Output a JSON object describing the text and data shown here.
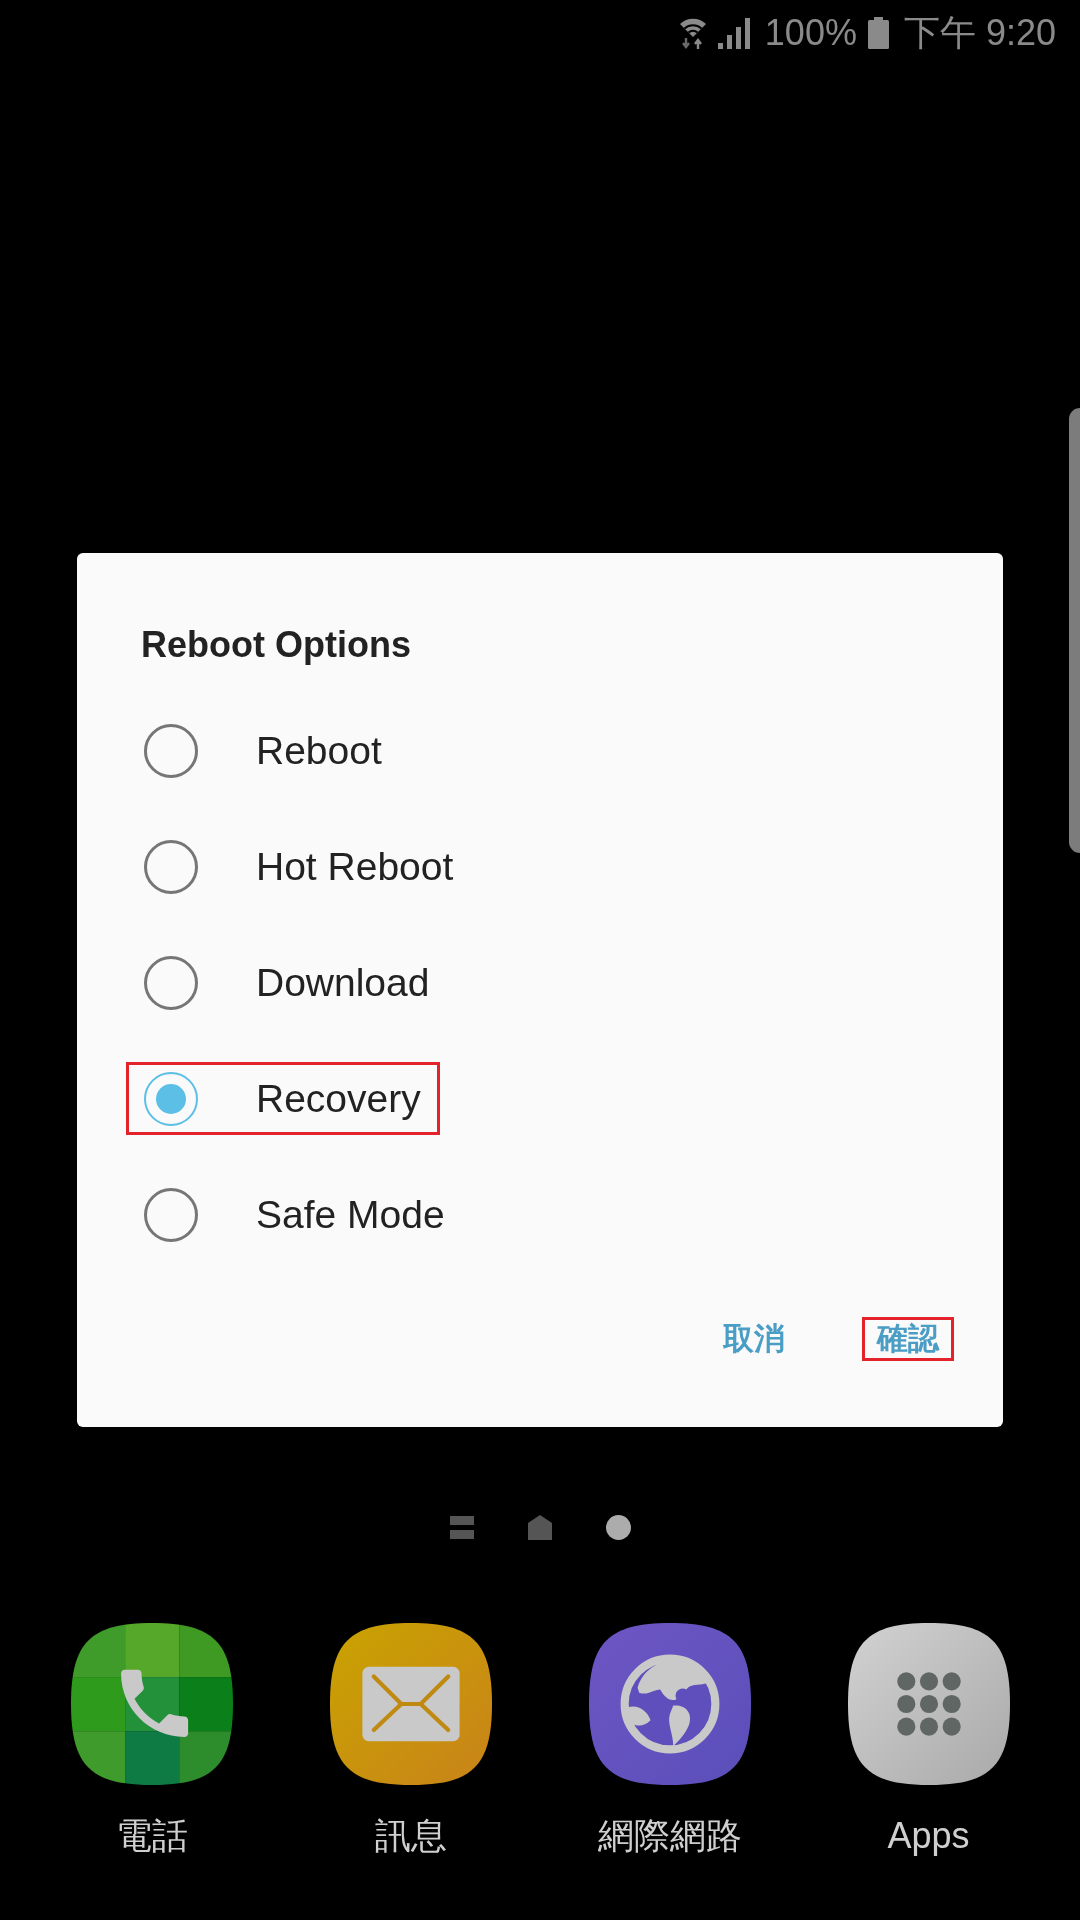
{
  "status_bar": {
    "battery_percent": "100%",
    "time": "下午 9:20"
  },
  "dialog": {
    "title": "Reboot Options",
    "options": [
      {
        "label": "Reboot",
        "selected": false,
        "highlighted": false
      },
      {
        "label": "Hot Reboot",
        "selected": false,
        "highlighted": false
      },
      {
        "label": "Download",
        "selected": false,
        "highlighted": false
      },
      {
        "label": "Recovery",
        "selected": true,
        "highlighted": true
      },
      {
        "label": "Safe Mode",
        "selected": false,
        "highlighted": false
      }
    ],
    "buttons": [
      {
        "label": "取消",
        "highlighted": false
      },
      {
        "label": "確認",
        "highlighted": true
      }
    ]
  },
  "page_indicators": [
    {
      "kind": "list",
      "selected": false
    },
    {
      "kind": "home",
      "selected": false
    },
    {
      "kind": "dot",
      "selected": true
    }
  ],
  "dock": [
    {
      "label": "電話",
      "kind": "phone"
    },
    {
      "label": "訊息",
      "kind": "messages"
    },
    {
      "label": "網際網路",
      "kind": "internet"
    },
    {
      "label": "Apps",
      "kind": "apps"
    }
  ]
}
